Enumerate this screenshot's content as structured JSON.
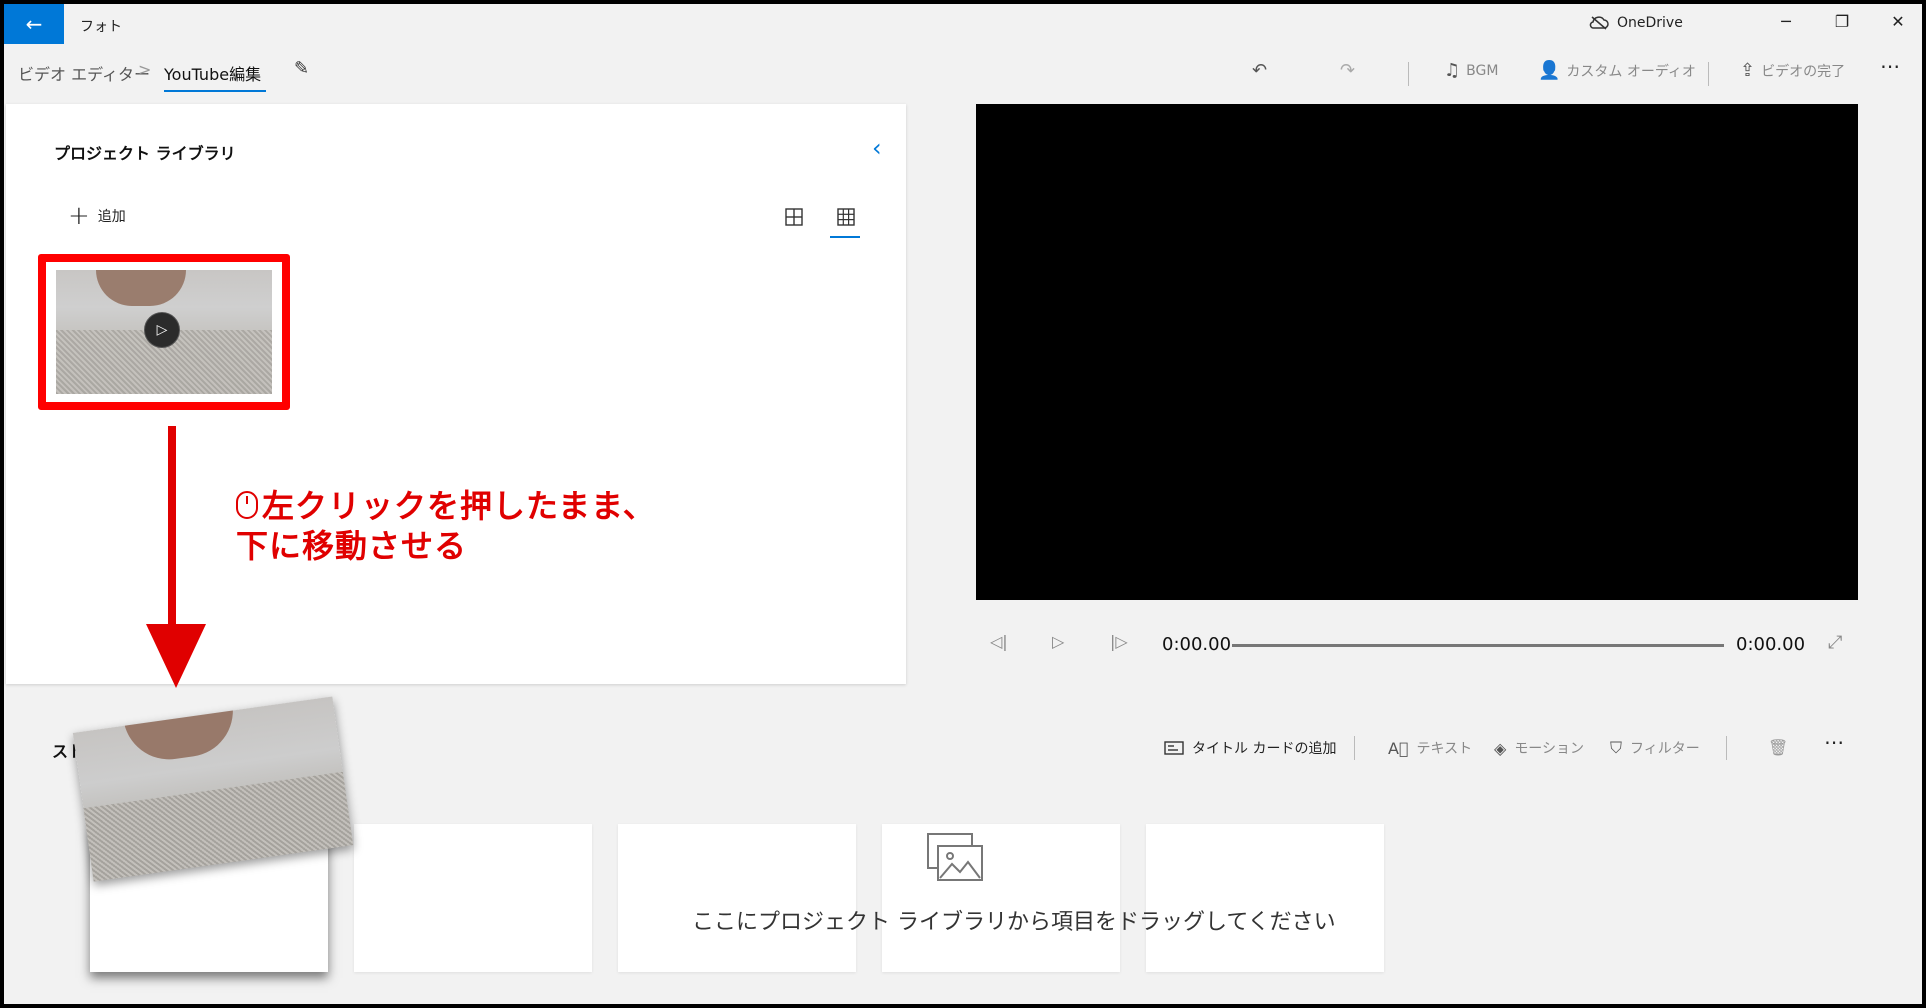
{
  "titlebar": {
    "app_title": "フォト",
    "onedrive_label": "OneDrive"
  },
  "breadcrumb": {
    "root": "ビデオ エディター",
    "separator": ">",
    "current": "YouTube編集"
  },
  "toolbar": {
    "bgm": "BGM",
    "custom_audio": "カスタム オーディオ",
    "finish_video": "ビデオの完了"
  },
  "library": {
    "title": "プロジェクト ライブラリ",
    "add_label": "追加"
  },
  "annotation": {
    "line1": "左クリックを押したまま、",
    "line2": "下に移動させる"
  },
  "player": {
    "current_time": "0:00.00",
    "total_time": "0:00.00"
  },
  "storyboard": {
    "title": "スト",
    "add_title_card": "タイトル カードの追加",
    "text": "テキスト",
    "motion": "モーション",
    "filter": "フィルター",
    "drop_hint": "ここにプロジェクト ライブラリから項目をドラッグしてください"
  },
  "colors": {
    "accent": "#0078d7",
    "annotation": "#e00000",
    "background": "#f2f2f2"
  },
  "icons": [
    "back-arrow-icon",
    "cloud-off-icon",
    "minimize-icon",
    "restore-icon",
    "close-icon",
    "pencil-icon",
    "undo-icon",
    "redo-icon",
    "music-note-icon",
    "person-audio-icon",
    "share-icon",
    "more-icon",
    "chevron-left-icon",
    "plus-icon",
    "grid-large-icon",
    "grid-small-icon",
    "play-icon",
    "step-back-icon",
    "step-forward-icon",
    "fullscreen-icon",
    "title-card-icon",
    "text-icon",
    "motion-icon",
    "filter-icon",
    "trash-icon",
    "image-drop-icon",
    "mouse-icon"
  ]
}
